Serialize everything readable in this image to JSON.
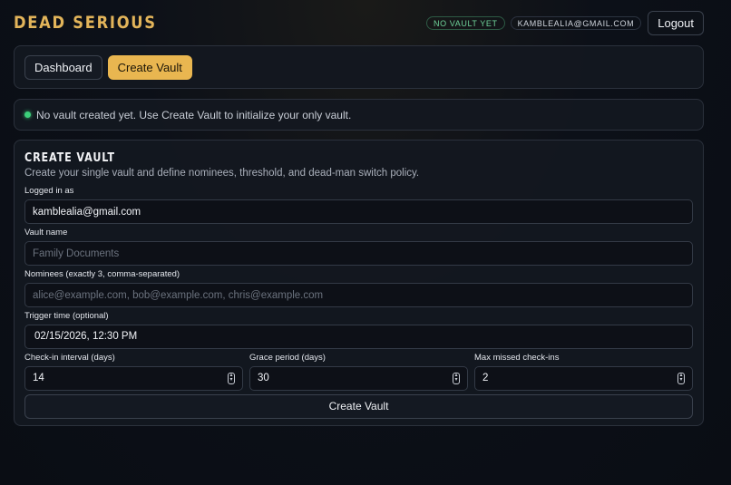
{
  "header": {
    "brand": "DEAD SERIOUS",
    "vault_status": "NO VAULT YET",
    "user_email": "KAMBLEALIA@GMAIL.COM",
    "logout_label": "Logout"
  },
  "nav": {
    "dashboard_label": "Dashboard",
    "create_vault_label": "Create Vault"
  },
  "notice": {
    "text": "No vault created yet. Use Create Vault to initialize your only vault."
  },
  "form": {
    "title": "CREATE VAULT",
    "subtitle": "Create your single vault and define nominees, threshold, and dead-man switch policy.",
    "logged_in_label": "Logged in as",
    "logged_in_value": "kamblealia@gmail.com",
    "vault_name_label": "Vault name",
    "vault_name_placeholder": "Family Documents",
    "nominees_label": "Nominees (exactly 3, comma-separated)",
    "nominees_placeholder": "alice@example.com, bob@example.com, chris@example.com",
    "trigger_label": "Trigger time (optional)",
    "trigger_value": "02/15/2026, 12:30 PM",
    "checkin_label": "Check-in interval (days)",
    "checkin_value": "14",
    "grace_label": "Grace period (days)",
    "grace_value": "30",
    "missed_label": "Max missed check-ins",
    "missed_value": "2",
    "submit_label": "Create Vault"
  },
  "colors": {
    "accent": "#e9b650",
    "brand": "#e2b45a",
    "status_green": "#3ccf7a"
  }
}
